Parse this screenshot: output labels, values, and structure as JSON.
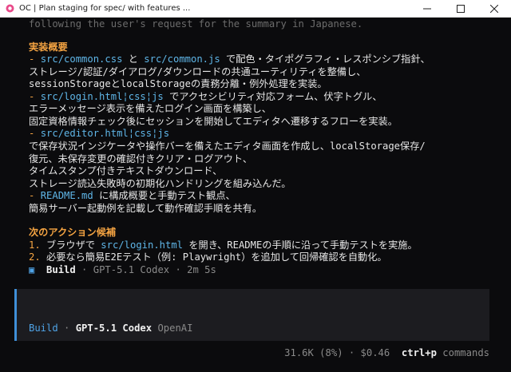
{
  "window": {
    "title": "OC | Plan staging for spec/ with features ...",
    "minimize_icon": "minimize-icon",
    "maximize_icon": "maximize-icon",
    "close_icon": "close-icon"
  },
  "transcript": {
    "top_line": "following the user's request for the summary in Japanese.",
    "section1_title": "実装概要",
    "items": [
      {
        "p1": "- ",
        "c1": "src/common.css",
        "t1": " と ",
        "c2": "src/common.js",
        "t2": " で配色・タイポグラフィ・レスポンシブ指針、"
      },
      {
        "t": "ストレージ/認証/ダイアログ/ダウンロードの共通ユーティリティを整備し、"
      },
      {
        "t": "sessionStorageとlocalStorageの責務分離・例外処理を実装。"
      },
      {
        "p1": "- ",
        "c1": "src/login.html¦css¦js",
        "t1": " でアクセシビリティ対応フォーム、伏字トグル、"
      },
      {
        "t": "エラーメッセージ表示を備えたログイン画面を構築し、"
      },
      {
        "t": "固定資格情報チェック後にセッションを開始してエディタへ遷移するフローを実装。"
      },
      {
        "p1": "- ",
        "c1": "src/editor.html¦css¦js"
      },
      {
        "t": "で保存状況インジケータや操作バーを備えたエディタ画面を作成し、localStorage保存/"
      },
      {
        "t": "復元、未保存変更の確認付きクリア・ログアウト、"
      },
      {
        "t": "タイムスタンプ付きテキストダウンロード、"
      },
      {
        "t": "ストレージ読込失敗時の初期化ハンドリングを組み込んだ。"
      },
      {
        "p1": "- ",
        "c1": "README.md",
        "t1": " に構成概要と手動テスト観点、"
      },
      {
        "t": "簡易サーバー起動例を記載して動作確認手順を共有。"
      }
    ],
    "section2_title": "次のアクション候補",
    "next_actions": [
      {
        "num": "1. ",
        "t1": "ブラウザで ",
        "c1": "src/login.html",
        "t2": " を開き、READMEの手順に沿って手動テストを実施。"
      },
      {
        "num": "2. ",
        "t1": "必要なら簡易E2Eテスト（例: Playwright）を追加して回帰確認を自動化。"
      }
    ],
    "build_line": {
      "icon": "square-icon",
      "mode": "Build",
      "sep1": " · ",
      "model": "GPT-5.1 Codex",
      "sep2": " · ",
      "duration": "2m 5s"
    }
  },
  "input": {
    "mode": "Build",
    "sep": " · ",
    "model": "GPT-5.1 Codex",
    "provider": "OpenAI"
  },
  "status": {
    "tokens": "31.6K (8%)",
    "sep": " · ",
    "cost": "$0.46",
    "shortcut": "ctrl+p",
    "shortcut_label": "commands"
  },
  "colors": {
    "accent_orange": "#f5a442",
    "path_blue": "#5fb6e8",
    "mode_blue": "#4fa3e6",
    "background": "#0b0b0d"
  }
}
